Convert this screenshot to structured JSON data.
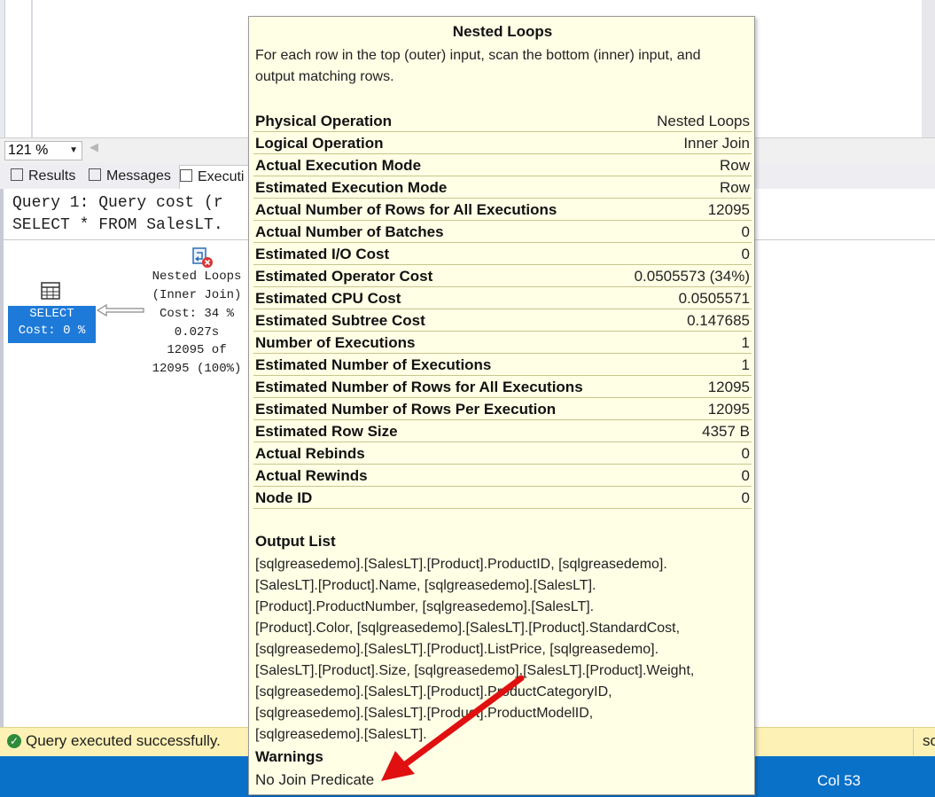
{
  "zoom": {
    "value": "121 %"
  },
  "tabs": [
    {
      "label": "Results"
    },
    {
      "label": "Messages"
    },
    {
      "label": "Executi"
    }
  ],
  "query_header": {
    "line1": "Query 1: Query cost (r",
    "line2": "SELECT * FROM SalesLT."
  },
  "plan": {
    "select_op": {
      "line1": "SELECT",
      "line2": "Cost: 0 %"
    },
    "nested_loops_op": {
      "line1": "Nested Loops",
      "line2": "(Inner Join)",
      "line3": "Cost: 34 %",
      "line4": "0.027s",
      "line5": "12095 of",
      "line6": "12095 (100%)"
    }
  },
  "tooltip": {
    "title": "Nested Loops",
    "description": "For each row in the top (outer) input, scan the bottom (inner) input, and output matching rows.",
    "properties": [
      {
        "key": "Physical Operation",
        "value": "Nested Loops"
      },
      {
        "key": "Logical Operation",
        "value": "Inner Join"
      },
      {
        "key": "Actual Execution Mode",
        "value": "Row"
      },
      {
        "key": "Estimated Execution Mode",
        "value": "Row"
      },
      {
        "key": "Actual Number of Rows for All Executions",
        "value": "12095"
      },
      {
        "key": "Actual Number of Batches",
        "value": "0"
      },
      {
        "key": "Estimated I/O Cost",
        "value": "0"
      },
      {
        "key": "Estimated Operator Cost",
        "value": "0.0505573 (34%)"
      },
      {
        "key": "Estimated CPU Cost",
        "value": "0.0505571"
      },
      {
        "key": "Estimated Subtree Cost",
        "value": "0.147685"
      },
      {
        "key": "Number of Executions",
        "value": "1"
      },
      {
        "key": "Estimated Number of Executions",
        "value": "1"
      },
      {
        "key": "Estimated Number of Rows for All Executions",
        "value": "12095"
      },
      {
        "key": "Estimated Number of Rows Per Execution",
        "value": "12095"
      },
      {
        "key": "Estimated Row Size",
        "value": "4357 B"
      },
      {
        "key": "Actual Rebinds",
        "value": "0"
      },
      {
        "key": "Actual Rewinds",
        "value": "0"
      },
      {
        "key": "Node ID",
        "value": "0"
      }
    ],
    "output_list_label": "Output List",
    "output_list_lines": [
      "[sqlgreasedemo].[SalesLT].[Product].ProductID, [sqlgreasedemo].",
      "[SalesLT].[Product].Name, [sqlgreasedemo].[SalesLT].",
      "[Product].ProductNumber, [sqlgreasedemo].[SalesLT].",
      "[Product].Color, [sqlgreasedemo].[SalesLT].[Product].StandardCost,",
      "[sqlgreasedemo].[SalesLT].[Product].ListPrice, [sqlgreasedemo].",
      "[SalesLT].[Product].Size,  [sqlgreasedemo].[SalesLT].[Product].Weight,",
      "[sqlgreasedemo].[SalesLT].[Product].ProductCategoryID,",
      "[sqlgreasedemo].[SalesLT].[Product].ProductModelID,",
      "[sqlgreasedemo].[SalesLT]."
    ],
    "warnings_label": "Warnings",
    "warnings_value": "No Join Predicate"
  },
  "status": {
    "message": "Query executed successfully.",
    "right_fragment": "sc"
  },
  "bottom_bar": {
    "col": "Col 53"
  },
  "colors": {
    "accent": "#0a71c9",
    "selected_op": "#1e7ad8",
    "tooltip_bg": "#ffffe6",
    "status_bg": "#fdf1b6",
    "annotation_arrow": "#e01010"
  }
}
